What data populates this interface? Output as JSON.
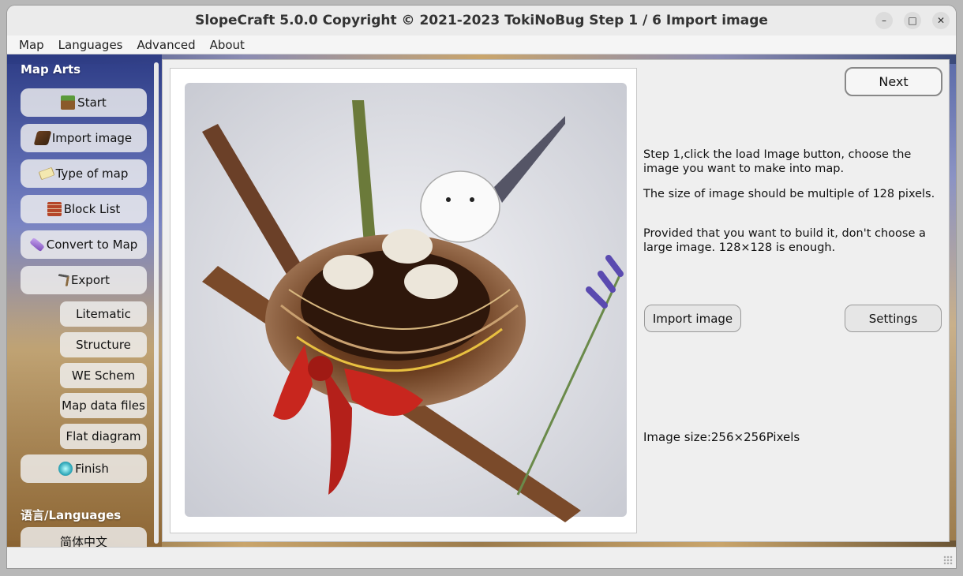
{
  "window": {
    "title": "SlopeCraft 5.0.0 Copyright © 2021-2023 TokiNoBug    Step 1 / 6    Import image",
    "minimize_icon": "–",
    "maximize_icon": "□",
    "close_icon": "✕"
  },
  "menu": [
    "Map",
    "Languages",
    "Advanced",
    "About"
  ],
  "sidebar": {
    "section_map_arts": "Map Arts",
    "section_languages": "语言/Languages",
    "items": [
      {
        "label": "Start",
        "icon": "grass-block-icon"
      },
      {
        "label": "Import image",
        "icon": "book-icon"
      },
      {
        "label": "Type of map",
        "icon": "map-icon"
      },
      {
        "label": "Block List",
        "icon": "brick-icon"
      },
      {
        "label": "Convert to Map",
        "icon": "potion-icon"
      },
      {
        "label": "Export",
        "icon": "pickaxe-icon"
      }
    ],
    "export_items": [
      "Litematic",
      "Structure",
      "WE Schem",
      "Map data files",
      "Flat diagram"
    ],
    "finish": {
      "label": "Finish",
      "icon": "diamond-icon"
    },
    "lang_item": "简体中文"
  },
  "main": {
    "next_label": "Next",
    "desc1": "Step 1,click the load Image button, choose the image you want to make into map.",
    "desc2": "The size of image should be multiple of 128 pixels.",
    "desc3": "Provided that you want to build it, don't choose a large image. 128×128 is enough.",
    "import_label": "Import image",
    "settings_label": "Settings",
    "image_size": "Image size:256×256Pixels"
  }
}
